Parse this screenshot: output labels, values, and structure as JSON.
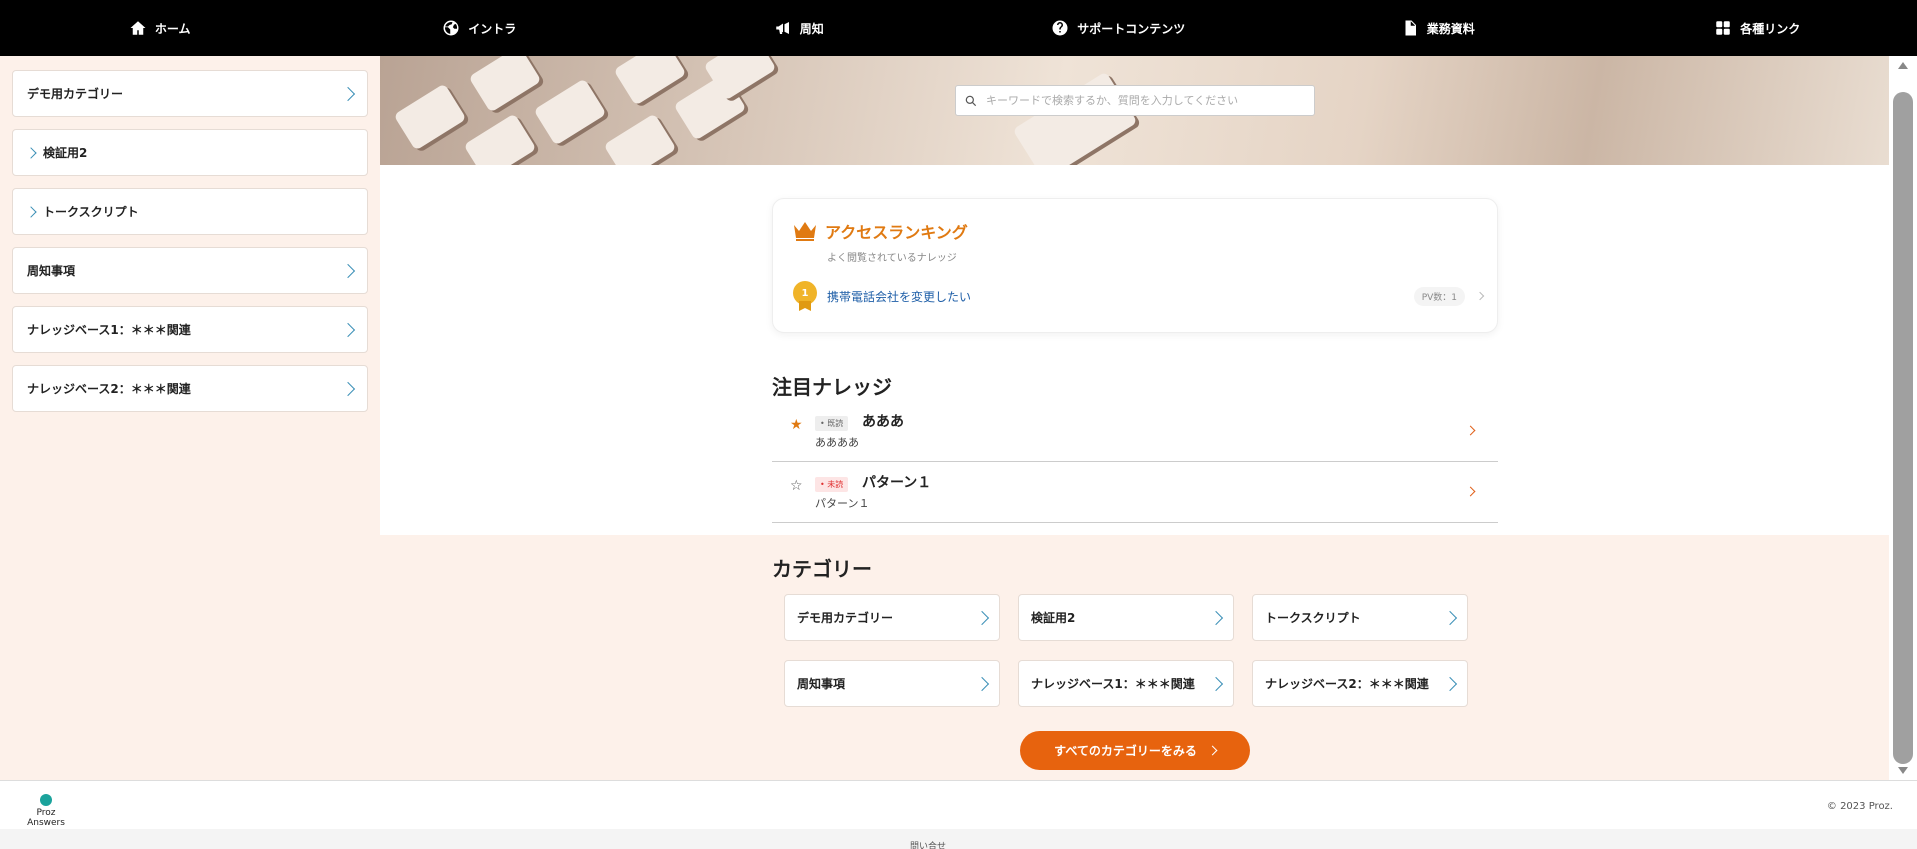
{
  "nav": {
    "items": [
      {
        "label": "ホーム",
        "icon": "home-icon"
      },
      {
        "label": "イントラ",
        "icon": "globe-icon"
      },
      {
        "label": "周知",
        "icon": "megaphone-icon"
      },
      {
        "label": "サポートコンテンツ",
        "icon": "question-icon"
      },
      {
        "label": "業務資料",
        "icon": "document-icon"
      },
      {
        "label": "各種リンク",
        "icon": "grid-icon"
      }
    ]
  },
  "sidebar": {
    "items": [
      {
        "label": "デモ用カテゴリー"
      },
      {
        "label": "検証用2"
      },
      {
        "label": "トークスクリプト"
      },
      {
        "label": "周知事項"
      },
      {
        "label": "ナレッジベース1：＊＊＊関連"
      },
      {
        "label": "ナレッジベース2：＊＊＊関連"
      }
    ]
  },
  "search": {
    "placeholder": "キーワードで検索するか、質問を入力してください"
  },
  "ranking": {
    "title": "アクセスランキング",
    "subtitle": "よく閲覧されているナレッジ",
    "items": [
      {
        "rank": "1",
        "title": "携帯電話会社を変更したい",
        "pv": "PV数：1"
      }
    ]
  },
  "featured": {
    "title": "注目ナレッジ",
    "items": [
      {
        "status": "• 既読",
        "title": "あああ",
        "description": "ああああ",
        "starred": true
      },
      {
        "status": "• 未読",
        "title": "パターン１",
        "description": "パターン１",
        "starred": false
      }
    ]
  },
  "categories": {
    "title": "カテゴリー",
    "items": [
      {
        "label": "デモ用カテゴリー"
      },
      {
        "label": "検証用2"
      },
      {
        "label": "トークスクリプト"
      },
      {
        "label": "周知事項"
      },
      {
        "label": "ナレッジベース1：＊＊＊関連"
      },
      {
        "label": "ナレッジベース2：＊＊＊関連"
      }
    ],
    "view_all": "すべてのカテゴリーをみる"
  },
  "footer": {
    "brand": "Proz Answers",
    "copyright": "© 2023 Proz.",
    "bottom_text": "問い合せ"
  },
  "colors": {
    "accent": "#e7630e",
    "link": "#1f5fa8",
    "chevron": "#3a8fb6",
    "nav_bg": "#000000",
    "page_bg": "#fdf1ea"
  }
}
